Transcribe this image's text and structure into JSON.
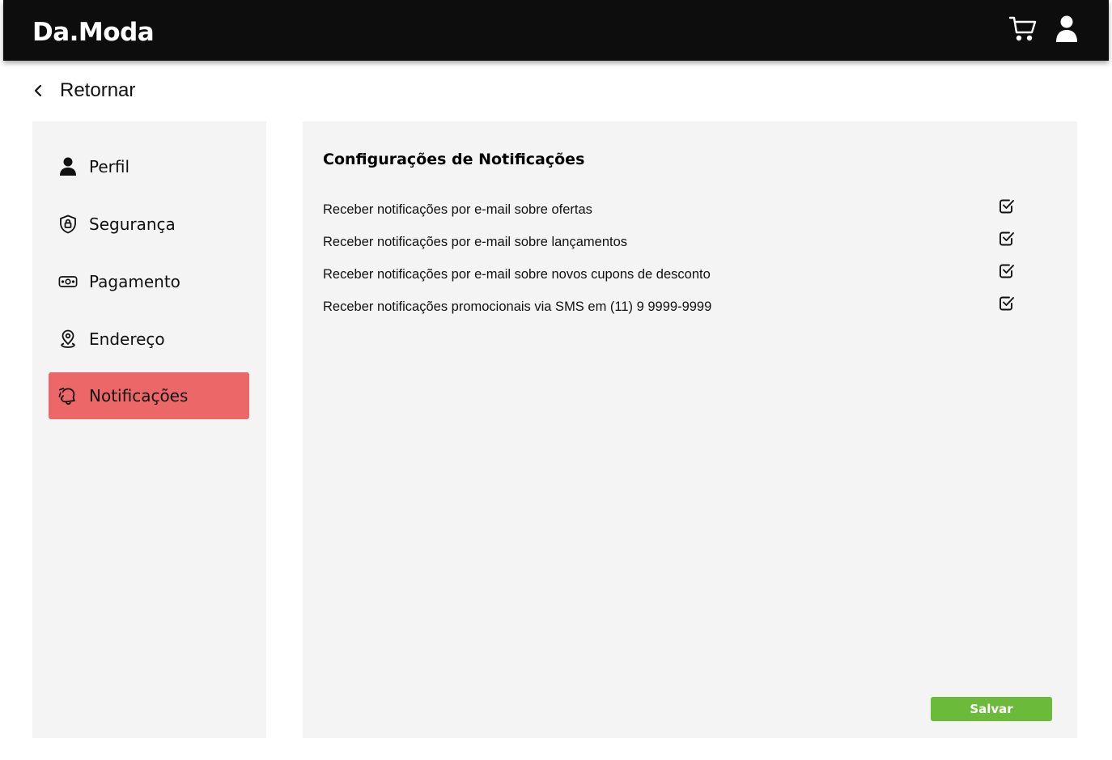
{
  "header": {
    "brand": "Da.Moda",
    "icons": [
      "cart-icon",
      "user-icon"
    ],
    "background": "#0d0d0d"
  },
  "back": {
    "label": "Retornar"
  },
  "sidebar": {
    "items": [
      {
        "label": "Perfil",
        "icon": "user-icon",
        "active": false
      },
      {
        "label": "Segurança",
        "icon": "shield-lock-icon",
        "active": false
      },
      {
        "label": "Pagamento",
        "icon": "money-icon",
        "active": false
      },
      {
        "label": "Endereço",
        "icon": "location-pin-icon",
        "active": false
      },
      {
        "label": "Notificações",
        "icon": "bell-off-icon",
        "active": true
      }
    ],
    "active_color": "#ec6767"
  },
  "panel": {
    "title": "Configurações de Notificações",
    "options": [
      {
        "label": "Receber notificações por e-mail sobre ofertas",
        "checked": true
      },
      {
        "label": "Receber notificações por e-mail sobre lançamentos",
        "checked": true
      },
      {
        "label": "Receber notificações por e-mail sobre novos cupons de desconto",
        "checked": true
      },
      {
        "label": "Receber notificações promocionais via SMS em (11) 9 9999-9999",
        "checked": true
      }
    ],
    "save_label": "Salvar",
    "save_color": "#6bba3a"
  }
}
